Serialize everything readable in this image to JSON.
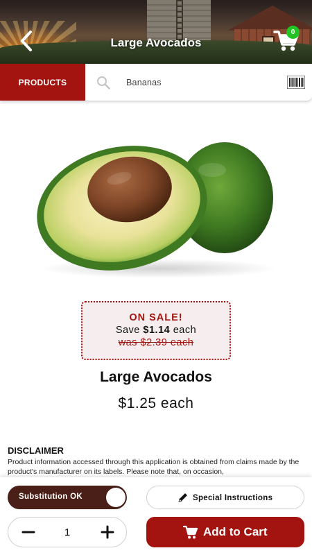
{
  "header": {
    "title": "Large Avocados",
    "back_icon": "chevron-left-icon",
    "cart_icon": "shopping-cart-icon",
    "cart_count": "0"
  },
  "searchbar": {
    "products_label": "PRODUCTS",
    "search_icon": "search-icon",
    "search_text": "Bananas",
    "barcode_icon": "barcode-icon"
  },
  "product": {
    "name": "Large Avocados",
    "price": "$1.25 each",
    "image": "avocado-image"
  },
  "sale": {
    "title": "ON SALE!",
    "save_prefix": "Save",
    "save_amount": "$1.14",
    "save_suffix": "each",
    "was": "was $2.39 each"
  },
  "disclaimer": {
    "title": "DISCLAIMER",
    "text": "Product information accessed through this application is obtained from claims made by the product's manufacturer on its labels. Please note that, on occasion,"
  },
  "actions": {
    "substitution_label": "Substitution OK",
    "special_instructions_label": "Special Instructions",
    "quantity": "1",
    "add_to_cart_label": "Add to Cart"
  },
  "colors": {
    "brand_red": "#a31410",
    "toggle_brown": "#4a1f17",
    "badge_green": "#22c322"
  }
}
